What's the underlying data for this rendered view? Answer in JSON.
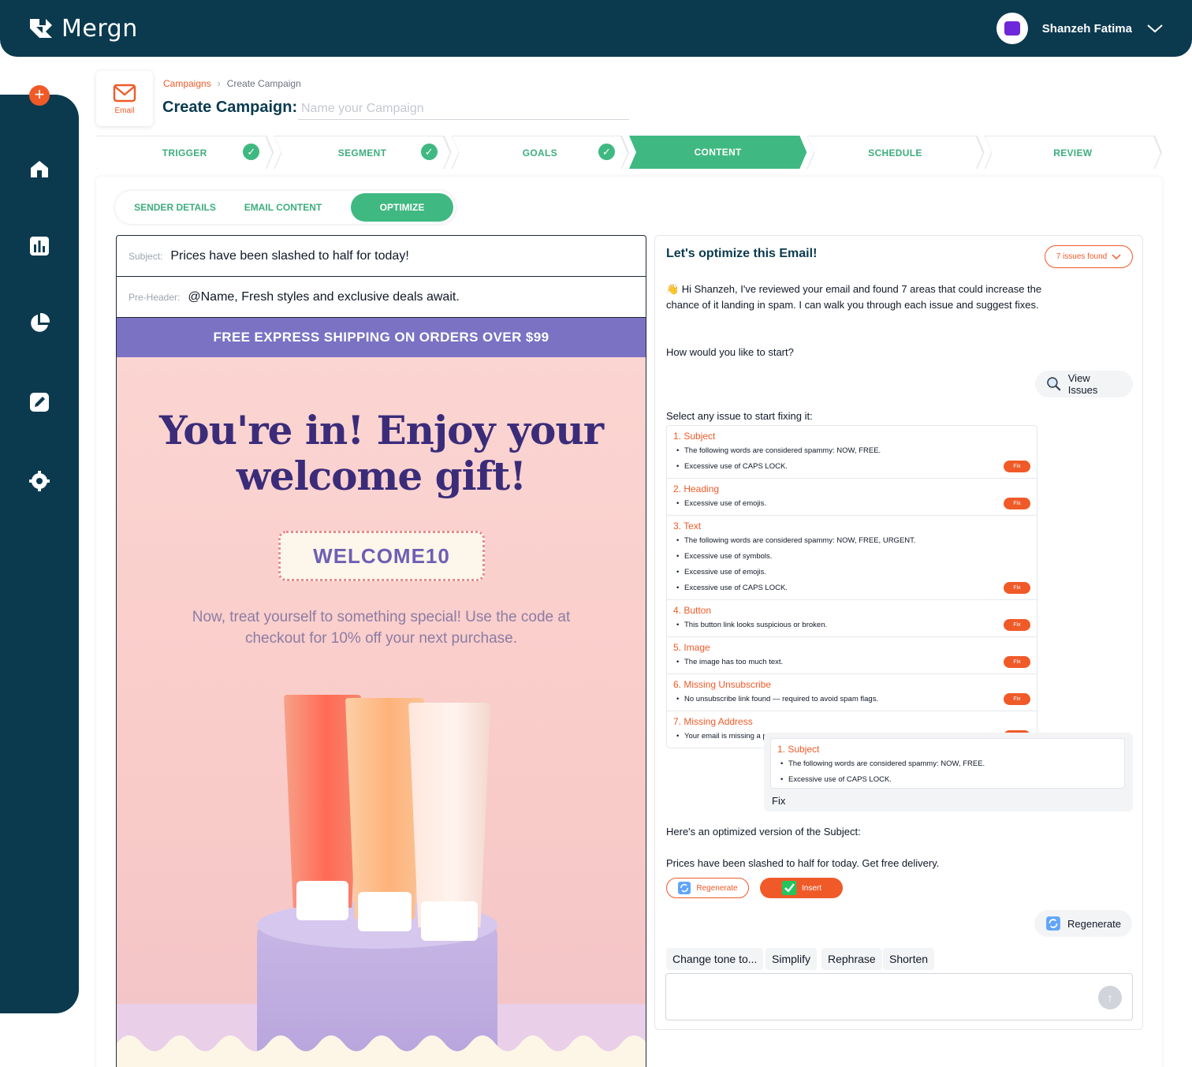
{
  "app": {
    "name": "Mergn"
  },
  "user": {
    "name": "Shanzeh Fatima"
  },
  "header": {
    "channel_label": "Email",
    "breadcrumb": [
      "Campaigns",
      "Create Campaign"
    ],
    "title": "Create Campaign:",
    "name_placeholder": "Name your Campaign"
  },
  "steps": [
    {
      "label": "TRIGGER",
      "done": true
    },
    {
      "label": "SEGMENT",
      "done": true
    },
    {
      "label": "GOALS",
      "done": true
    },
    {
      "label": "CONTENT",
      "active": true
    },
    {
      "label": "SCHEDULE"
    },
    {
      "label": "REVIEW"
    }
  ],
  "subtabs": [
    "SENDER DETAILS",
    "EMAIL CONTENT",
    "OPTIMIZE"
  ],
  "preview": {
    "subject_label": "Subject:",
    "subject": "Prices have been slashed to half for today!",
    "preheader_label": "Pre-Header:",
    "preheader": "@Name, Fresh styles and exclusive deals await.",
    "banner": "FREE EXPRESS SHIPPING ON ORDERS OVER $99",
    "hero_title_line1": "You're in! Enjoy your",
    "hero_title_line2": "welcome gift!",
    "coupon": "WELCOME10",
    "hero_text": "Now, treat yourself to something special! Use the code at checkout for 10% off your next purchase."
  },
  "panel": {
    "title": "Let's optimize this Email!",
    "issues_badge": "7 issues found",
    "intro": "👋 Hi Shanzeh, I've reviewed your email and found 7 areas that could increase the chance of it landing in spam. I can walk you through each issue and suggest fixes.",
    "question": "How would you like to start?",
    "view_issues": "View Issues",
    "select_label": "Select any issue to start fixing it:",
    "fix_label": "Fix",
    "issues": [
      {
        "title": "1. Subject",
        "points": [
          "The following words are considered spammy: NOW, FREE.",
          "Excessive use of CAPS LOCK."
        ]
      },
      {
        "title": "2. Heading",
        "points": [
          "Excessive use of emojis."
        ]
      },
      {
        "title": "3. Text",
        "points": [
          "The following words are considered spammy: NOW, FREE, URGENT.",
          "Excessive use of symbols.",
          "Excessive use of emojis.",
          "Excessive use of CAPS LOCK."
        ]
      },
      {
        "title": "4. Button",
        "points": [
          "This button link looks suspicious or broken."
        ]
      },
      {
        "title": "5. Image",
        "points": [
          "The image has too much text."
        ]
      },
      {
        "title": "6. Missing Unsubscribe",
        "points": [
          "No unsubscribe link found — required to avoid spam flags."
        ]
      },
      {
        "title": "7. Missing Address",
        "points": [
          "Your email is missing a physical address — this is a compliance requirement."
        ]
      }
    ],
    "selected": {
      "title": "1. Subject",
      "points": [
        "The following words are considered spammy: NOW, FREE.",
        "Excessive use of CAPS LOCK."
      ],
      "action": "Fix"
    },
    "optimized_label": "Here's an optimized version of the Subject:",
    "optimized_value": "Prices have been slashed to half for today. Get free delivery.",
    "regenerate_small": "Regenerate",
    "insert": "Insert",
    "regenerate": "Regenerate",
    "chips": [
      "Change tone to...",
      "Simplify",
      "Rephrase",
      "Shorten"
    ]
  },
  "colors": {
    "brand": "#0b3a4f",
    "accent": "#f05a28",
    "success": "#3fb981",
    "banner": "#7b72c4"
  }
}
